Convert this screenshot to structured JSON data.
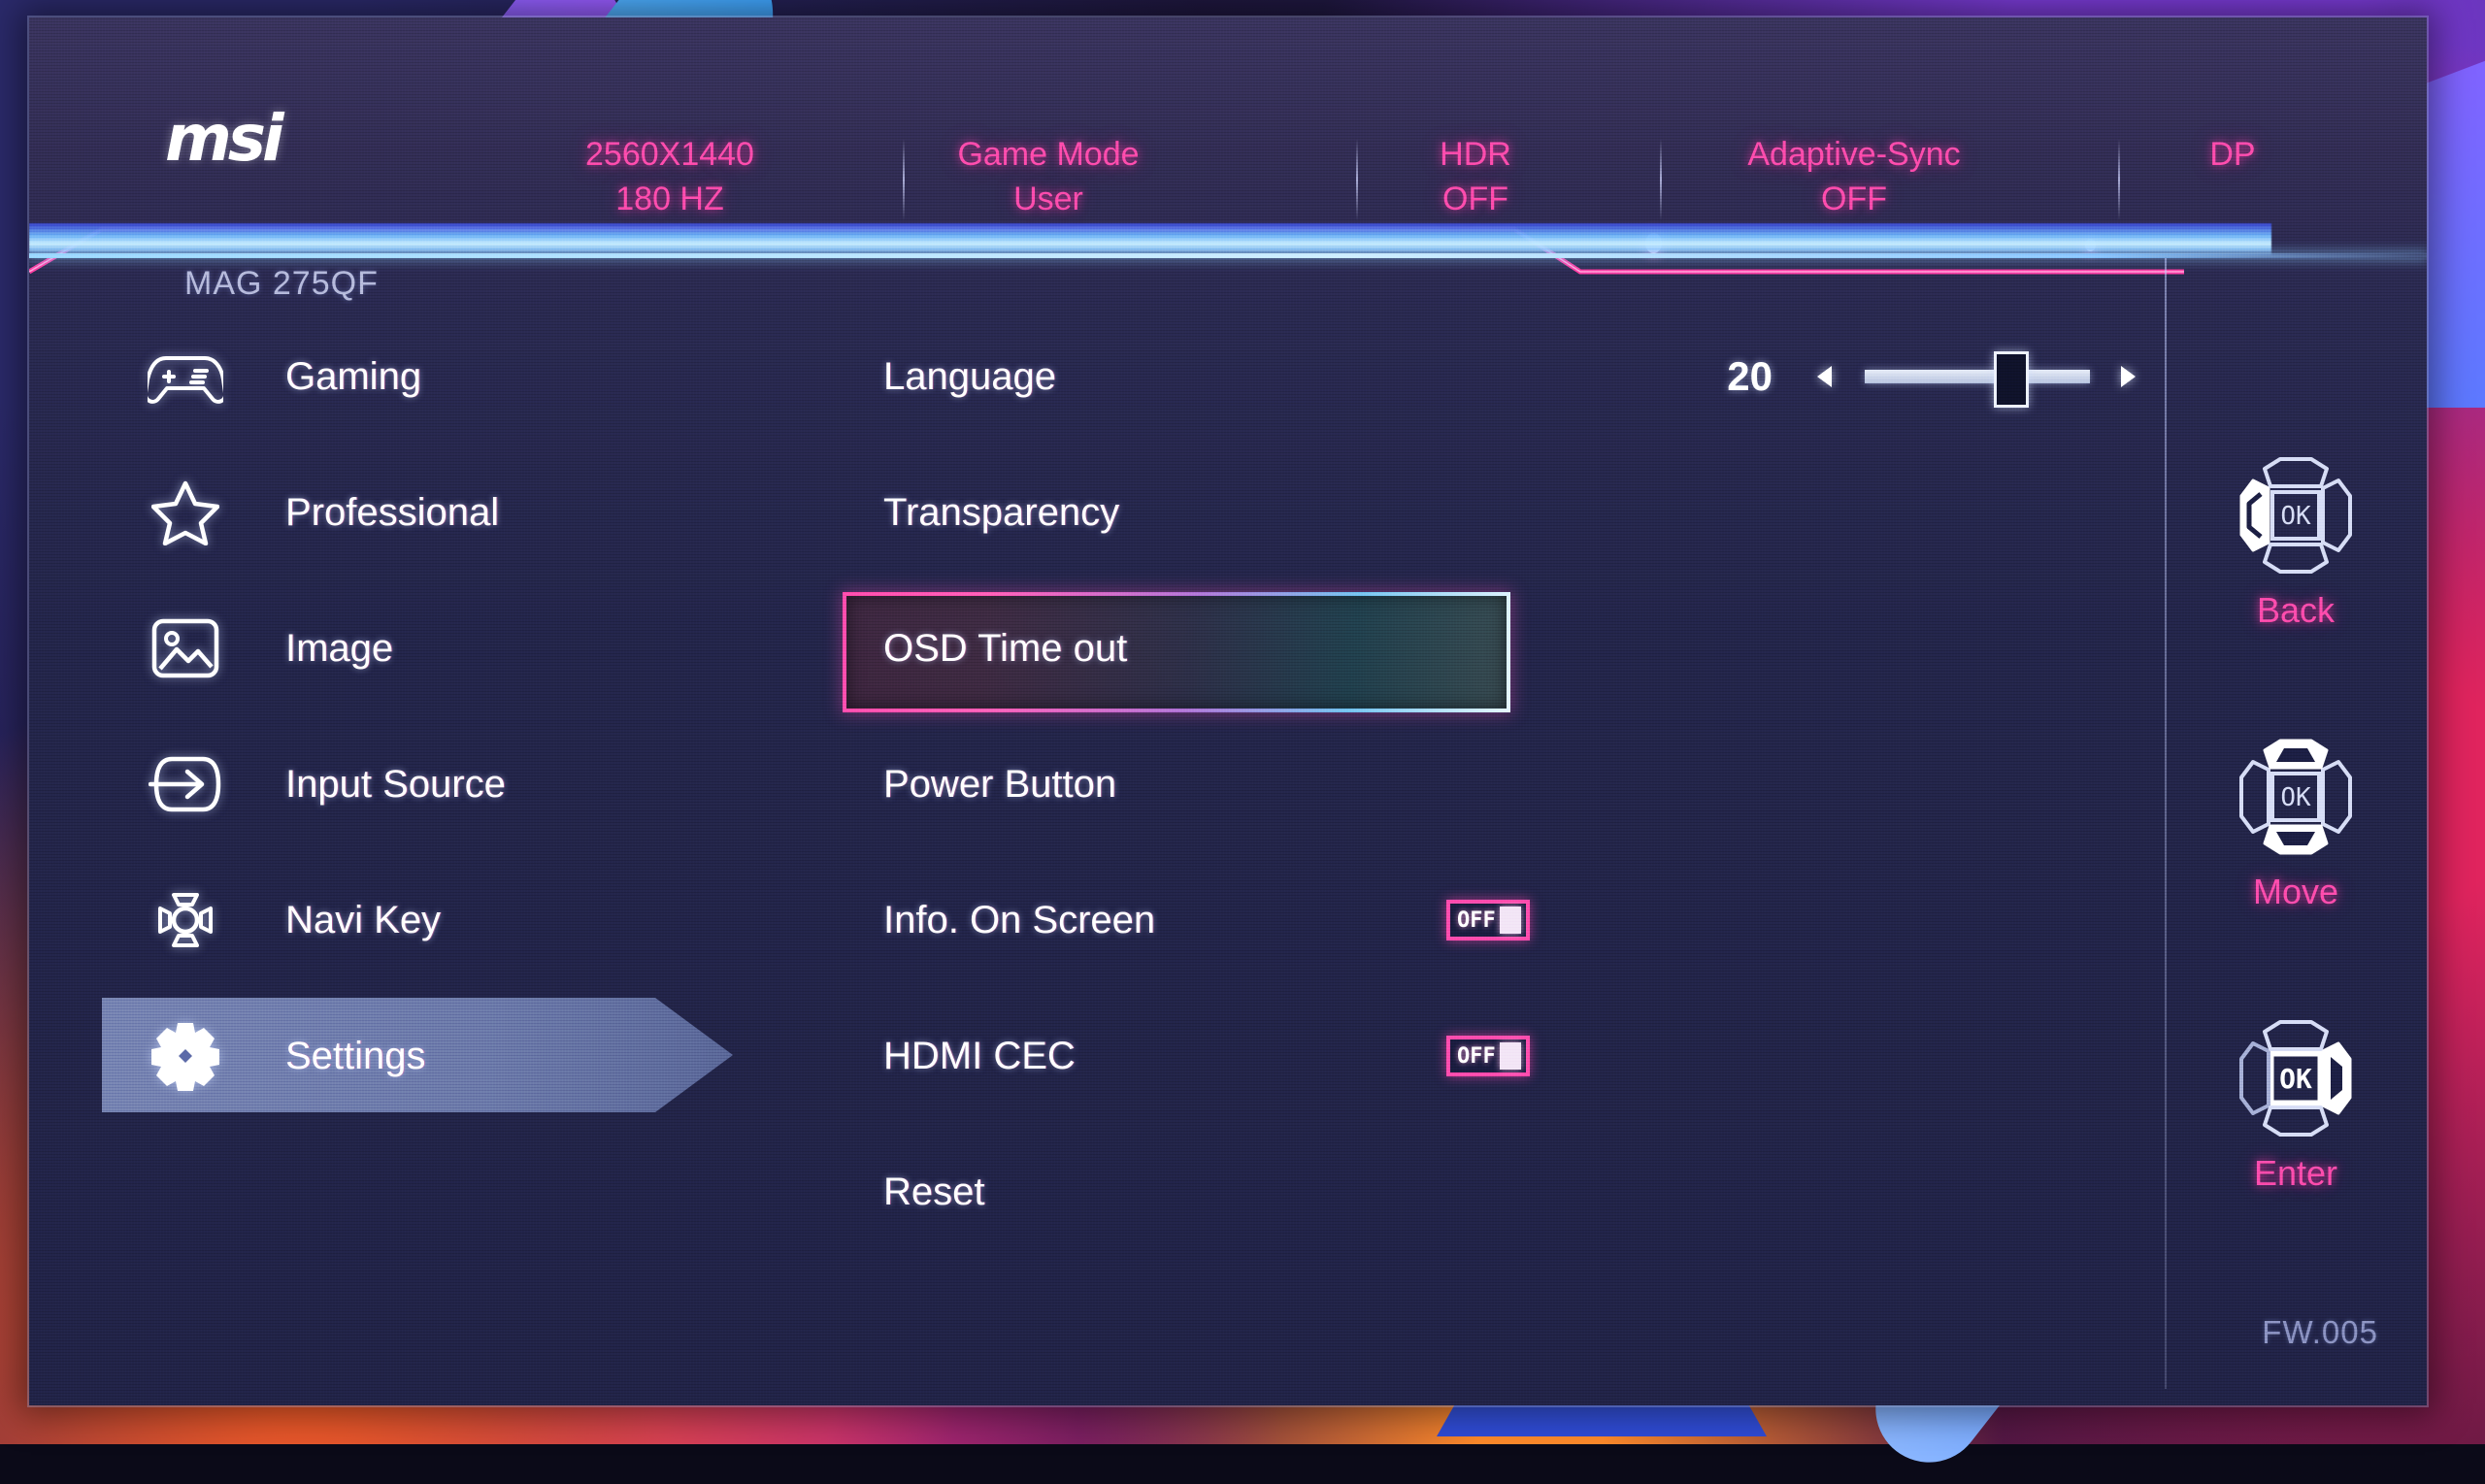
{
  "brand": {
    "logo": "msi",
    "model": "MAG 275QF",
    "firmware": "FW.005"
  },
  "status_bar": [
    {
      "name": "resolution",
      "line1": "2560X1440",
      "line2": "180 HZ"
    },
    {
      "name": "game-mode",
      "line1": "Game Mode",
      "line2": "User"
    },
    {
      "name": "hdr",
      "line1": "HDR",
      "line2": "OFF"
    },
    {
      "name": "adaptive-sync",
      "line1": "Adaptive-Sync",
      "line2": "OFF"
    },
    {
      "name": "input",
      "line1": "DP",
      "line2": ""
    }
  ],
  "sidebar": {
    "items": [
      {
        "label": "Gaming",
        "icon": "gamepad-icon",
        "selected": false
      },
      {
        "label": "Professional",
        "icon": "star-icon",
        "selected": false
      },
      {
        "label": "Image",
        "icon": "picture-icon",
        "selected": false
      },
      {
        "label": "Input Source",
        "icon": "input-arrow-icon",
        "selected": false
      },
      {
        "label": "Navi Key",
        "icon": "navi-key-icon",
        "selected": false
      },
      {
        "label": "Settings",
        "icon": "gear-icon",
        "selected": true
      }
    ]
  },
  "main": {
    "rows": [
      {
        "label": "Language",
        "control": "slider",
        "selected": false
      },
      {
        "label": "Transparency",
        "control": "none",
        "selected": false
      },
      {
        "label": "OSD Time out",
        "control": "none",
        "selected": true
      },
      {
        "label": "Power Button",
        "control": "none",
        "selected": false
      },
      {
        "label": "Info. On Screen",
        "control": "toggle",
        "value": "OFF",
        "selected": false
      },
      {
        "label": "HDMI CEC",
        "control": "toggle",
        "value": "OFF",
        "selected": false
      },
      {
        "label": "Reset",
        "control": "none",
        "selected": false
      }
    ],
    "slider": {
      "value": "20",
      "percent": 64,
      "left_arrow": "triangle-left-icon",
      "right_arrow": "triangle-right-icon"
    }
  },
  "nav_hints": [
    {
      "label": "Back",
      "icon": "navi-key-left-icon",
      "highlight": "left"
    },
    {
      "label": "Move",
      "icon": "navi-key-updown-icon",
      "highlight": "updown"
    },
    {
      "label": "Enter",
      "icon": "navi-key-ok-icon",
      "highlight": "ok"
    }
  ],
  "colors": {
    "accent_pink": "#ff4fb0",
    "panel_bg": "#24264c",
    "highlight_row": "#aec3f5",
    "text": "#ffffff",
    "divider_cyan": "#cfeeff"
  }
}
